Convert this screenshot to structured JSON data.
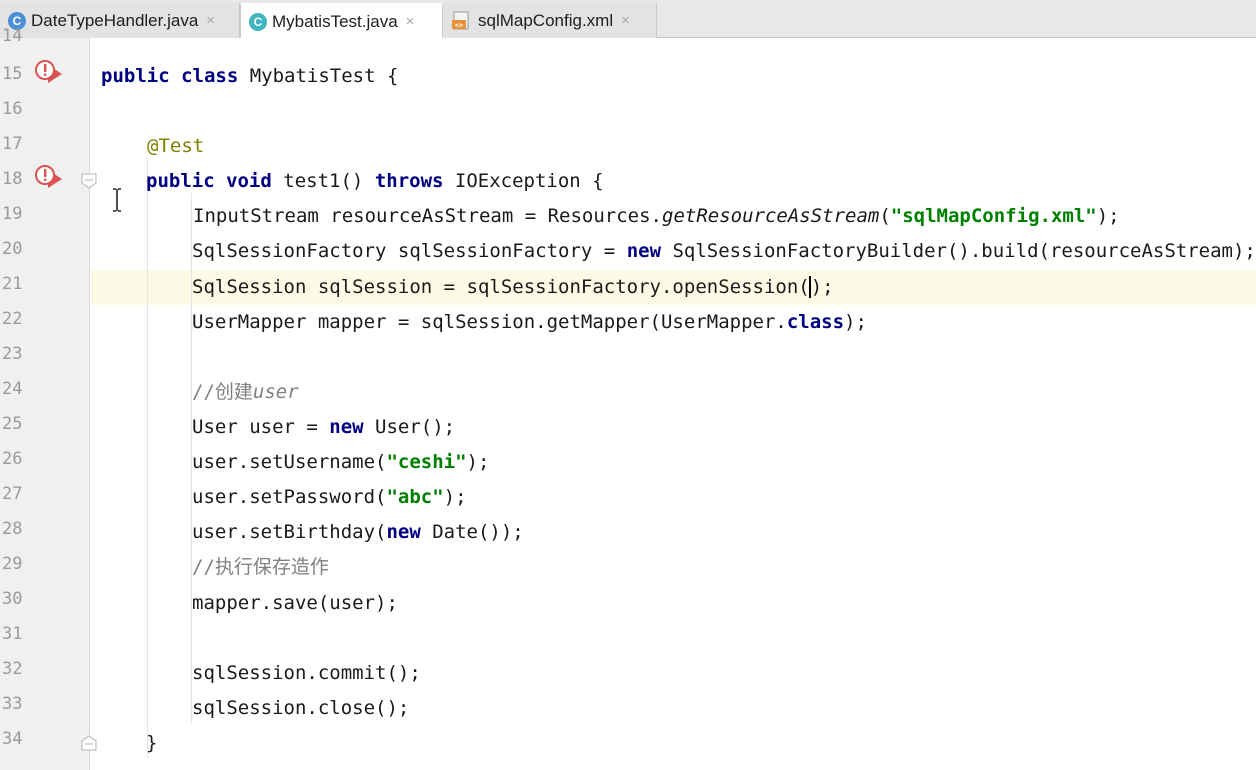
{
  "tabs": [
    {
      "label": "DateTypeHandler.java",
      "icon": "class-icon",
      "active": false
    },
    {
      "label": "MybatisTest.java",
      "icon": "class-test-icon",
      "active": true
    },
    {
      "label": "sqlMapConfig.xml",
      "icon": "xml-icon",
      "active": false
    }
  ],
  "close_glyph": "×",
  "line_numbers": [
    "14",
    "15",
    "16",
    "17",
    "18",
    "19",
    "20",
    "21",
    "22",
    "23",
    "24",
    "25",
    "26",
    "27",
    "28",
    "29",
    "30",
    "31",
    "32",
    "33",
    "34"
  ],
  "code": {
    "l15": {
      "kw1": "public",
      "kw2": "class",
      "rest": " MybatisTest {"
    },
    "l17": {
      "ann": "@Test"
    },
    "l18": {
      "kw1": "public",
      "kw2": "void",
      "mid": " test1() ",
      "kw3": "throws",
      "rest": " IOException {"
    },
    "l19": {
      "a": "InputStream resourceAsStream = Resources.",
      "b": "getResourceAsStream",
      "c": "(",
      "s": "\"sqlMapConfig.xml\"",
      "d": ");"
    },
    "l20": {
      "a": "SqlSessionFactory sqlSessionFactory = ",
      "kw": "new",
      "b": " SqlSessionFactoryBuilder().build(resourceAsStream);"
    },
    "l21": {
      "a": "SqlSession sqlSession = sqlSessionFactory.openSession(",
      "b": ");"
    },
    "l22": {
      "a": "UserMapper mapper = sqlSession.getMapper(UserMapper.",
      "kw": "class",
      "b": ");"
    },
    "l24": {
      "a": "//创建",
      "b": "user"
    },
    "l25": {
      "a": "User user = ",
      "kw": "new",
      "b": " User();"
    },
    "l26": {
      "a": "user.setUsername(",
      "s": "\"ceshi\"",
      "b": ");"
    },
    "l27": {
      "a": "user.setPassword(",
      "s": "\"abc\"",
      "b": ");"
    },
    "l28": {
      "a": "user.setBirthday(",
      "kw": "new",
      "b": " Date());"
    },
    "l29": {
      "a": "//执行保存造作"
    },
    "l30": {
      "a": "mapper.save(user);"
    },
    "l32": {
      "a": "sqlSession.commit();"
    },
    "l33": {
      "a": "sqlSession.close();"
    },
    "l34": {
      "a": "}"
    }
  },
  "colors": {
    "keyword": "#000080",
    "string": "#008000",
    "annotation": "#808000",
    "comment": "#808080",
    "current_line": "#fdfbe6",
    "run_icon": "#d9534f"
  }
}
